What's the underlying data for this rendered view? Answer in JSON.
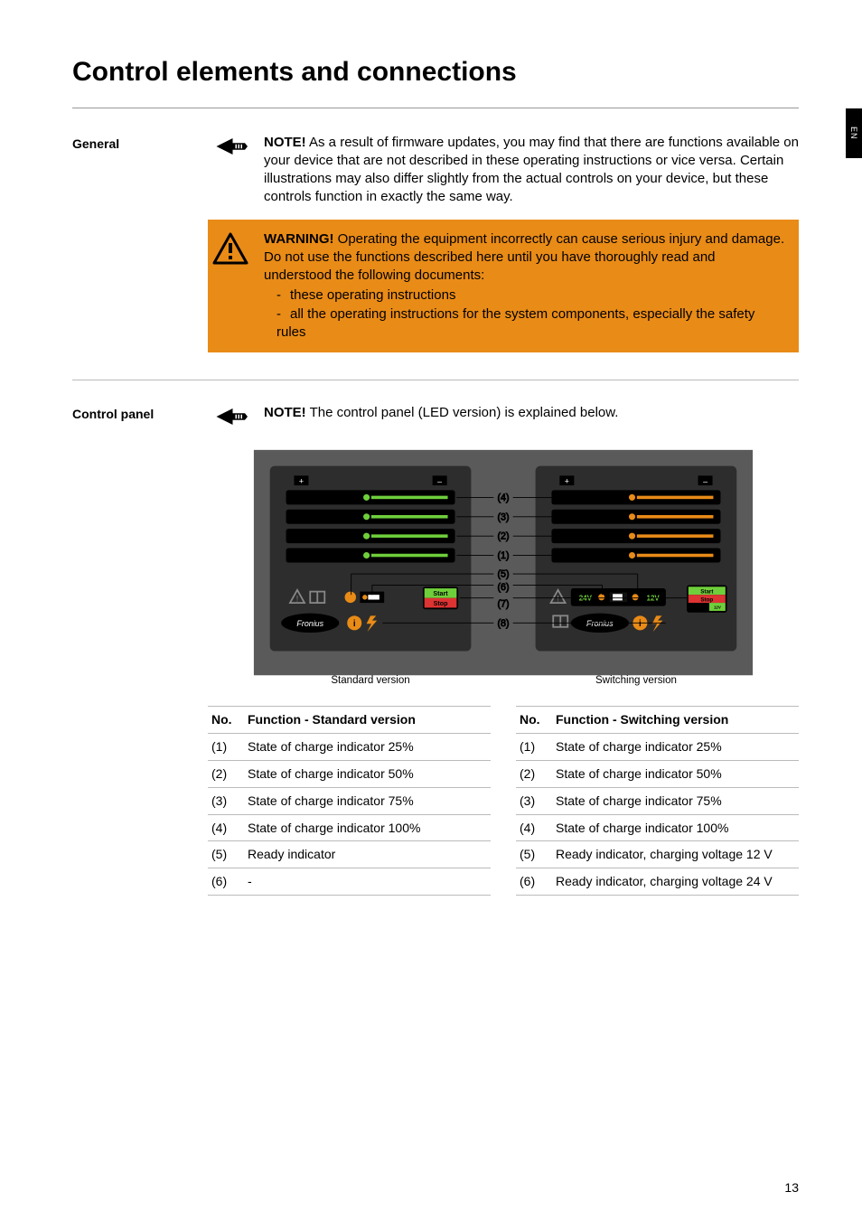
{
  "lang_tab": "EN",
  "title": "Control elements and connections",
  "page_number": "13",
  "sections": {
    "general": {
      "label": "General",
      "note_lead": "NOTE!",
      "note_body": " As a result of firmware updates, you may find that there are functions available on your device that are not described in these operating instructions or vice versa. Certain illustrations may also differ slightly from the actual controls on your device, but these controls function in exactly the same way.",
      "warn_lead": "WARNING!",
      "warn_body": " Operating the equipment incorrectly can cause serious injury and damage. Do not use the functions described here until you have thoroughly read and understood the following documents:",
      "warn_item1": "these operating instructions",
      "warn_item2": "all the operating instructions for the system components, especially the safety rules"
    },
    "panel": {
      "label": "Control panel",
      "note_lead": "NOTE!",
      "note_body": " The control panel (LED version) is explained below.",
      "caption_std": "Standard version",
      "caption_sw": "Switching version",
      "callouts": [
        "(4)",
        "(3)",
        "(2)",
        "(1)",
        "(5)",
        "(6)",
        "(7)",
        "(8)"
      ],
      "svg_text": {
        "plus": "+",
        "minus": "–",
        "start": "Start",
        "stop": "Stop",
        "brand": "Fronius",
        "v24": "24V",
        "v12": "12V",
        "v12_24": "12V\n24V"
      }
    }
  },
  "tables": {
    "std": {
      "head_no": "No.",
      "head_fn": "Function - Standard version",
      "rows": [
        {
          "no": "(1)",
          "fn": "State of charge indicator 25%"
        },
        {
          "no": "(2)",
          "fn": "State of charge indicator 50%"
        },
        {
          "no": "(3)",
          "fn": "State of charge indicator 75%"
        },
        {
          "no": "(4)",
          "fn": "State of charge indicator 100%"
        },
        {
          "no": "(5)",
          "fn": "Ready indicator"
        },
        {
          "no": "(6)",
          "fn": "-"
        }
      ]
    },
    "sw": {
      "head_no": "No.",
      "head_fn": "Function - Switching version",
      "rows": [
        {
          "no": "(1)",
          "fn": "State of charge indicator 25%"
        },
        {
          "no": "(2)",
          "fn": "State of charge indicator 50%"
        },
        {
          "no": "(3)",
          "fn": "State of charge indicator 75%"
        },
        {
          "no": "(4)",
          "fn": "State of charge indicator 100%"
        },
        {
          "no": "(5)",
          "fn": "Ready indicator, charging voltage 12 V"
        },
        {
          "no": "(6)",
          "fn": "Ready indicator, charging voltage 24 V"
        }
      ]
    }
  }
}
